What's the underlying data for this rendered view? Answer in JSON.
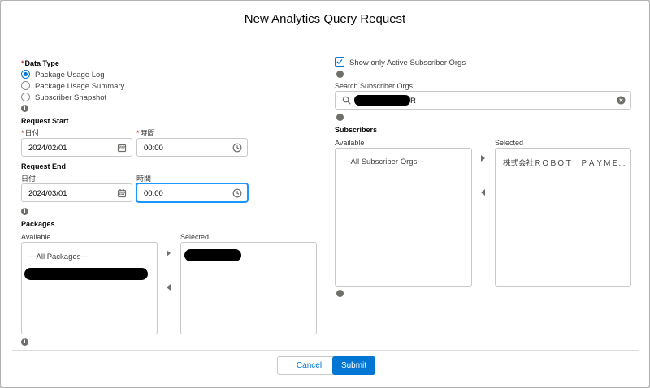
{
  "modal": {
    "title": "New Analytics Query Request"
  },
  "data_type": {
    "label": "Data Type",
    "required_mark": "*",
    "options": [
      "Package Usage Log",
      "Package Usage Summary",
      "Subscriber Snapshot"
    ],
    "selected": "Package Usage Log"
  },
  "request_start": {
    "label": "Request Start",
    "date_label": "日付",
    "time_label": "時間",
    "required_mark": "*",
    "date_value": "2024/02/01",
    "time_value": "00:00"
  },
  "request_end": {
    "label": "Request End",
    "date_label": "日付",
    "time_label": "時間",
    "date_value": "2024/03/01",
    "time_value": "00:00"
  },
  "packages": {
    "label": "Packages",
    "available_label": "Available",
    "selected_label": "Selected",
    "available_items": [
      "---All Packages---"
    ],
    "trailing_char": "."
  },
  "subscriber_filter": {
    "checkbox_label": "Show only Active Subscriber Orgs",
    "checked": true
  },
  "search": {
    "label": "Search Subscriber Orgs",
    "value_suffix": "R"
  },
  "subscribers": {
    "label": "Subscribers",
    "available_label": "Available",
    "selected_label": "Selected",
    "available_items": [
      "---All Subscriber Orgs---"
    ],
    "selected_items": [
      "株式会社ＲＯＢＯＴ　ＰＡＹＭＥ..."
    ]
  },
  "footer": {
    "cancel_label": "Cancel",
    "submit_label": "Submit"
  },
  "colors": {
    "brand": "#0176d3",
    "required": "#c23934",
    "focus": "#1b96ff"
  }
}
